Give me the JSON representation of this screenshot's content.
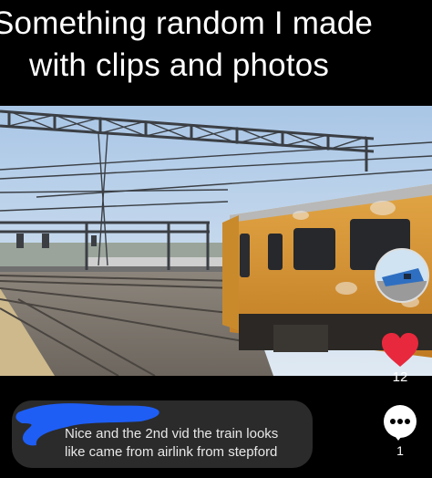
{
  "caption": {
    "line1": "Something random I made",
    "line2": "with clips and photos"
  },
  "actions": {
    "like_icon": "heart-icon",
    "like_count": "12",
    "comment_icon": "comment-dots-icon",
    "comment_count": "1"
  },
  "comment": {
    "text_line1": "Nice and the 2nd vid the train looks",
    "text_line2": "like came from airlink from stepford"
  },
  "colors": {
    "background": "#000000",
    "like": "#e8283c",
    "redaction": "#1e5ef5",
    "train": "#d8952b",
    "bubble": "#2b2b2b"
  }
}
